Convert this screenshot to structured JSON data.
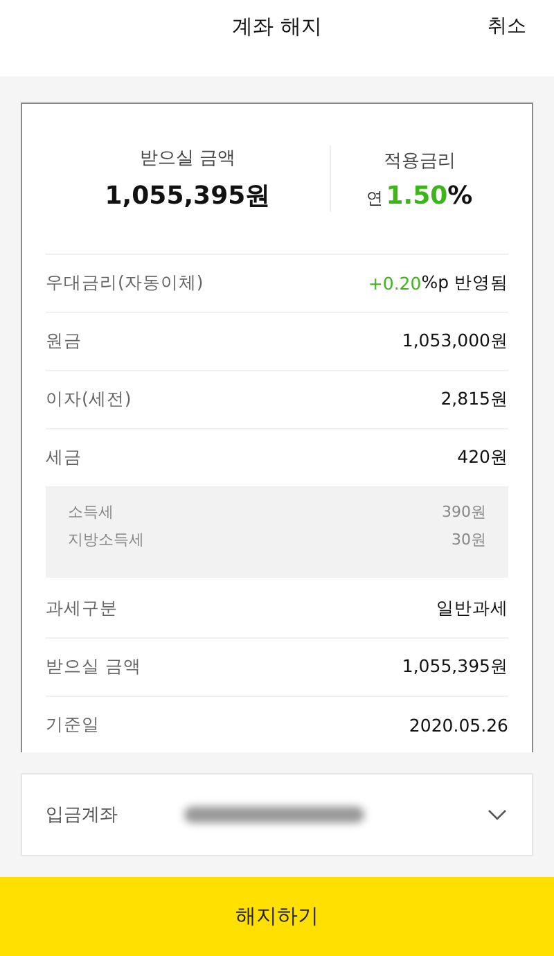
{
  "header": {
    "title": "계좌 해지",
    "cancel": "취소"
  },
  "summary": {
    "amount_label": "받으실 금액",
    "amount": "1,055,395원",
    "rate_label": "적용금리",
    "rate_prefix": "연",
    "rate_value": "1.50",
    "rate_suffix": "%"
  },
  "rows": [
    {
      "label": "우대금리(자동이체)",
      "value_highlight": "+0.20",
      "value": "%p 반영됨"
    },
    {
      "label": "원금",
      "value": "1,053,000원"
    },
    {
      "label": "이자(세전)",
      "value": "2,815원"
    },
    {
      "label": "세금",
      "value": "420원",
      "breakdown": [
        {
          "label": "소득세",
          "value": "390원"
        },
        {
          "label": "지방소득세",
          "value": "30원"
        }
      ]
    },
    {
      "label": "과세구분",
      "value": "일반과세"
    },
    {
      "label": "받으실 금액",
      "value": "1,055,395원"
    },
    {
      "label": "기준일",
      "value": "2020.05.26"
    }
  ],
  "deposit_account": {
    "label": "입금계좌"
  },
  "submit_button": "해지하기"
}
